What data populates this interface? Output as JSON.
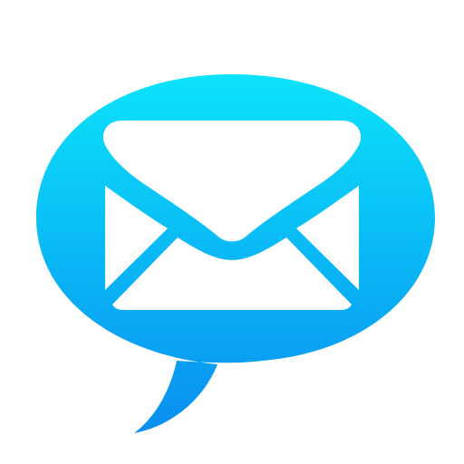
{
  "icon": {
    "name": "mail-chat-bubble-icon",
    "colors": {
      "background": "#ffffff",
      "bubble_top": "#0be3fb",
      "bubble_bottom": "#0a8ef0",
      "envelope": "#ffffff"
    }
  }
}
